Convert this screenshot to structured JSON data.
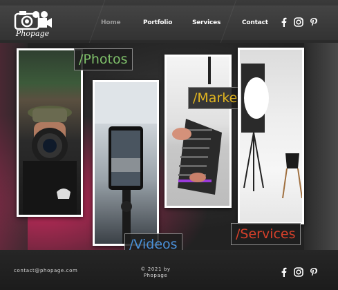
{
  "brand": {
    "logo_text": "Phopage"
  },
  "nav": {
    "items": [
      {
        "label": "Home",
        "active": true
      },
      {
        "label": "Portfolio",
        "active": false
      },
      {
        "label": "Services",
        "active": false
      },
      {
        "label": "Contact",
        "active": false
      }
    ]
  },
  "social": [
    "facebook-icon",
    "instagram-icon",
    "pinterest-icon"
  ],
  "labels": {
    "photos": "/Photos",
    "videos": "/Videos",
    "marketing": "/Marketing",
    "services": "/Services"
  },
  "colors": {
    "photos": "#7fc06a",
    "videos": "#4a90d9",
    "marketing": "#e0b420",
    "services": "#d6402a"
  },
  "footer": {
    "email": "contact@phopage.com",
    "copyright_line1": "© 2021 by",
    "copyright_line2": "Phopage"
  }
}
